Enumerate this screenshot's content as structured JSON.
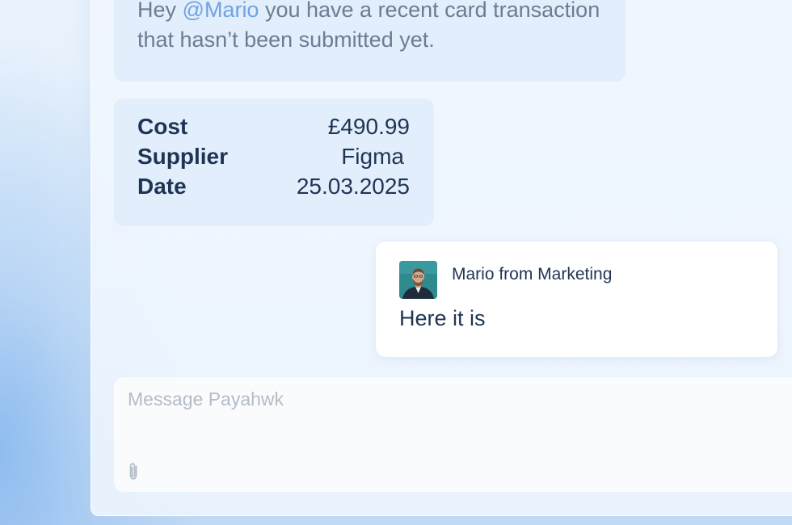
{
  "bot_message": {
    "greeting": "Hey",
    "mention": "@Mario",
    "text": "you have a recent card transaction that hasn’t been submitted yet."
  },
  "transaction": {
    "rows": [
      {
        "label": "Cost",
        "value": "£490.99"
      },
      {
        "label": "Supplier",
        "value": "Figma"
      },
      {
        "label": "Date",
        "value": "25.03.2025"
      }
    ]
  },
  "user_message": {
    "sender": "Mario from Marketing",
    "text": "Here it is"
  },
  "composer": {
    "placeholder": "Message Payahwk",
    "attach_icon": "paperclip-icon"
  },
  "colors": {
    "mention": "#6fa2e3",
    "text_dark": "#1f3454",
    "text_muted": "#6b7d93",
    "card_bg": "#e2eefb"
  }
}
